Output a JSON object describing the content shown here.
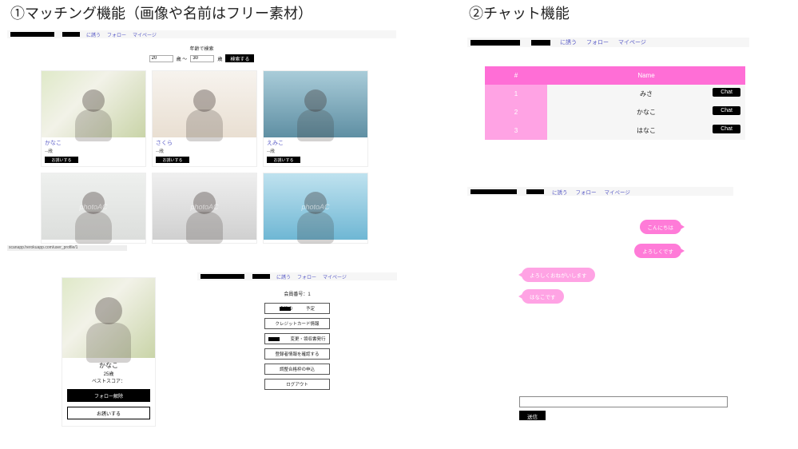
{
  "titles": {
    "matching": "①マッチング機能（画像や名前はフリー素材）",
    "chat": "②チャット機能"
  },
  "nav": {
    "invite": "に誘う",
    "follow": "フォロー",
    "mypage": "マイページ"
  },
  "search": {
    "label": "年齢で検索",
    "from": "20",
    "unit_from": "歳 〜",
    "to": "30",
    "unit_to": "歳",
    "button": "検索する"
  },
  "card_button": "お誘いする",
  "cards": [
    {
      "name": "かなこ",
      "age": "--歳"
    },
    {
      "name": "さくら",
      "age": "--歳"
    },
    {
      "name": "えみこ",
      "age": "--歳"
    },
    {
      "name": "",
      "age": ""
    },
    {
      "name": "",
      "age": ""
    },
    {
      "name": "",
      "age": ""
    }
  ],
  "watermark": "photoAC",
  "status_url": "scanapp.herokuapp.com/user_profile/1",
  "profile": {
    "name": "かなこ",
    "age": "25歳",
    "score_label": "ベストスコア：",
    "btn_unfollow": "フォロー解除",
    "btn_invite": "お誘いする"
  },
  "menu": {
    "title": "会員番号：1",
    "items": [
      "今後の　　　予定",
      "クレジットカード情報",
      "　　変更・領収書発行",
      "登録者情報を確認する",
      "調整合格枠の申込",
      "ログアウト"
    ]
  },
  "chatlist": {
    "head_idx": "#",
    "head_name": "Name",
    "btn": "Chat",
    "rows": [
      {
        "idx": "1",
        "name": "みさ"
      },
      {
        "idx": "2",
        "name": "かなこ"
      },
      {
        "idx": "3",
        "name": "はなこ"
      }
    ]
  },
  "thread": {
    "msgs": [
      {
        "side": "right",
        "text": "こんにちは"
      },
      {
        "side": "right",
        "text": "よろしくです"
      },
      {
        "side": "left",
        "text": "よろしくおねがいします"
      },
      {
        "side": "left",
        "text": "はなこです"
      }
    ],
    "send": "送信"
  }
}
